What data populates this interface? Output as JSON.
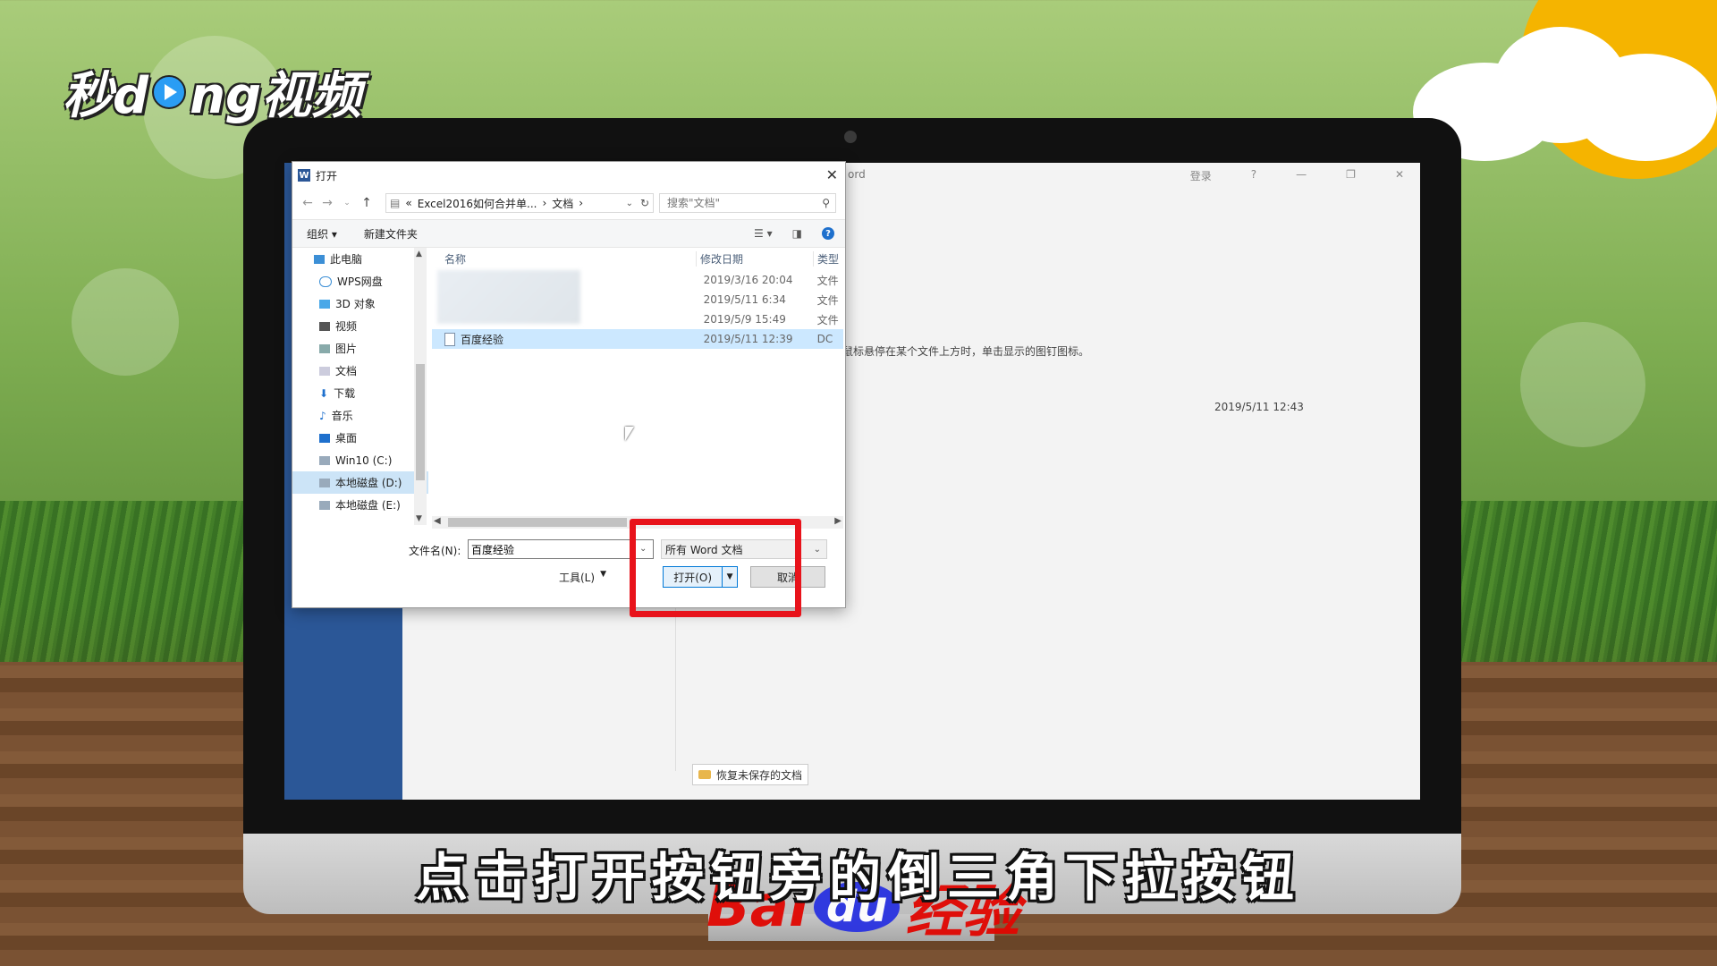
{
  "brand": {
    "logo_text_1": "秒d",
    "logo_text_2": "ng视频"
  },
  "word": {
    "title_fragment": "ord",
    "login": "登录",
    "help": "?",
    "minimize": "—",
    "restore": "❐",
    "close": "✕",
    "tip_text": "鼠标悬停在某个文件上方时，单击显示的图钉图标。",
    "recent_date": "2019/5/11 12:43",
    "recover_button": "恢复未保存的文档"
  },
  "dialog": {
    "title": "打开",
    "close": "✕",
    "address": {
      "prefix": "«",
      "crumb_1": "Excel2016如何合并单...",
      "sep": "›",
      "crumb_2": "文档",
      "sep2": "›"
    },
    "search_placeholder": "搜索\"文档\"",
    "toolbar": {
      "organize": "组织 ▾",
      "new_folder": "新建文件夹"
    },
    "nav_items": [
      {
        "label": "此电脑",
        "icon": "computer-icon"
      },
      {
        "label": "WPS网盘",
        "icon": "cloud-icon"
      },
      {
        "label": "3D 对象",
        "icon": "cube-icon"
      },
      {
        "label": "视频",
        "icon": "video-icon"
      },
      {
        "label": "图片",
        "icon": "picture-icon"
      },
      {
        "label": "文档",
        "icon": "document-icon"
      },
      {
        "label": "下载",
        "icon": "download-icon"
      },
      {
        "label": "音乐",
        "icon": "music-icon"
      },
      {
        "label": "桌面",
        "icon": "desktop-icon"
      },
      {
        "label": "Win10 (C:)",
        "icon": "drive-icon"
      },
      {
        "label": "本地磁盘 (D:)",
        "icon": "drive-icon"
      },
      {
        "label": "本地磁盘 (E:)",
        "icon": "drive-icon"
      }
    ],
    "columns": {
      "name": "名称",
      "date": "修改日期",
      "type": "类型"
    },
    "files": [
      {
        "name": "",
        "date": "2019/3/16 20:04",
        "type": "文件"
      },
      {
        "name": "",
        "date": "2019/5/11 6:34",
        "type": "文件"
      },
      {
        "name": "",
        "date": "2019/5/9 15:49",
        "type": "文件"
      },
      {
        "name": "百度经验",
        "date": "2019/5/11 12:39",
        "type": "DC"
      }
    ],
    "filename_label": "文件名(N):",
    "filename_value": "百度经验",
    "filetype": "所有 Word 文档",
    "tools": "工具(L)",
    "open": "打开(O)",
    "cancel": "取消"
  },
  "subtitle": "点击打开按钮旁的倒三角下拉按钮",
  "watermark": {
    "bai": "Bai",
    "du": "du",
    "jingyan": "经验"
  },
  "colors": {
    "highlight": "#e8131b",
    "word_blue": "#2b5797",
    "selection": "#cce8ff"
  }
}
